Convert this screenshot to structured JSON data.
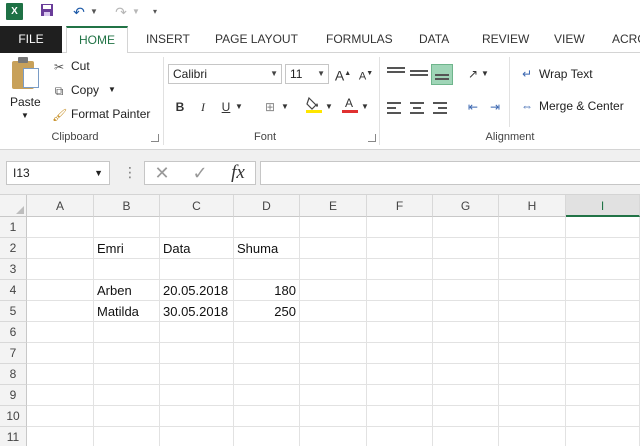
{
  "app": {
    "logo_text": "X"
  },
  "tabs": [
    "FILE",
    "HOME",
    "INSERT",
    "PAGE LAYOUT",
    "FORMULAS",
    "DATA",
    "REVIEW",
    "VIEW",
    "ACRO"
  ],
  "ribbon": {
    "clipboard": {
      "paste": "Paste",
      "cut": "Cut",
      "copy": "Copy",
      "format_painter": "Format Painter",
      "label": "Clipboard"
    },
    "font": {
      "name": "Calibri",
      "size": "11",
      "grow": "A",
      "shrink": "A",
      "bold": "B",
      "italic": "I",
      "underline": "U",
      "label": "Font"
    },
    "alignment": {
      "wrap_text": "Wrap Text",
      "merge_center": "Merge & Center",
      "label": "Alignment"
    }
  },
  "formula_bar": {
    "name_box": "I13",
    "fx": "fx",
    "cancel": "✕",
    "enter": "✓",
    "value": ""
  },
  "grid": {
    "columns": [
      "A",
      "B",
      "C",
      "D",
      "E",
      "F",
      "G",
      "H",
      "I"
    ],
    "selected_column": "I",
    "rows": [
      "1",
      "2",
      "3",
      "4",
      "5",
      "6",
      "7",
      "8",
      "9",
      "10",
      "11"
    ],
    "cells": {
      "B2": "Emri",
      "C2": "Data",
      "D2": "Shuma",
      "B4": "Arben",
      "C4": "20.05.2018",
      "D4": "180",
      "B5": "Matilda",
      "C5": "30.05.2018",
      "D5": "250"
    }
  },
  "colors": {
    "accent": "#217346",
    "file_tab": "#1f1f1f"
  }
}
